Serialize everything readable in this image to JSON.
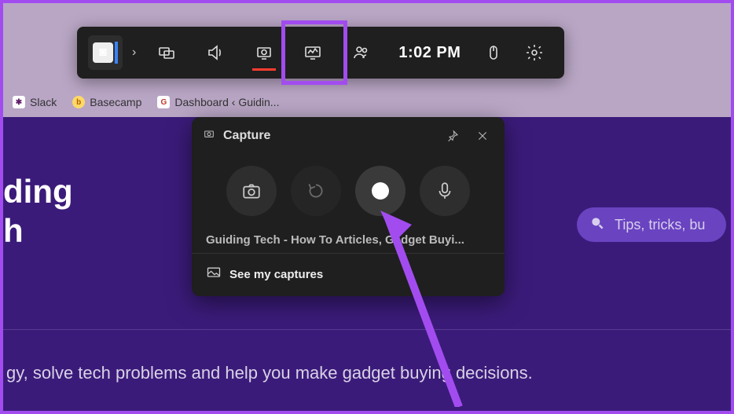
{
  "bookmarks": {
    "items": [
      {
        "label": "Slack"
      },
      {
        "label": "Basecamp"
      },
      {
        "label": "Dashboard ‹ Guidin..."
      }
    ]
  },
  "page": {
    "headline_line1": "ding",
    "headline_line2": "h",
    "subline": "gy, solve tech problems and help you make gadget buying decisions.",
    "search_placeholder": "Tips, tricks, bu"
  },
  "xbar": {
    "time": "1:02 PM"
  },
  "capture": {
    "title": "Capture",
    "context_line": "Guiding Tech - How To Articles, Gadget Buyi...",
    "footer_label": "See my captures"
  }
}
